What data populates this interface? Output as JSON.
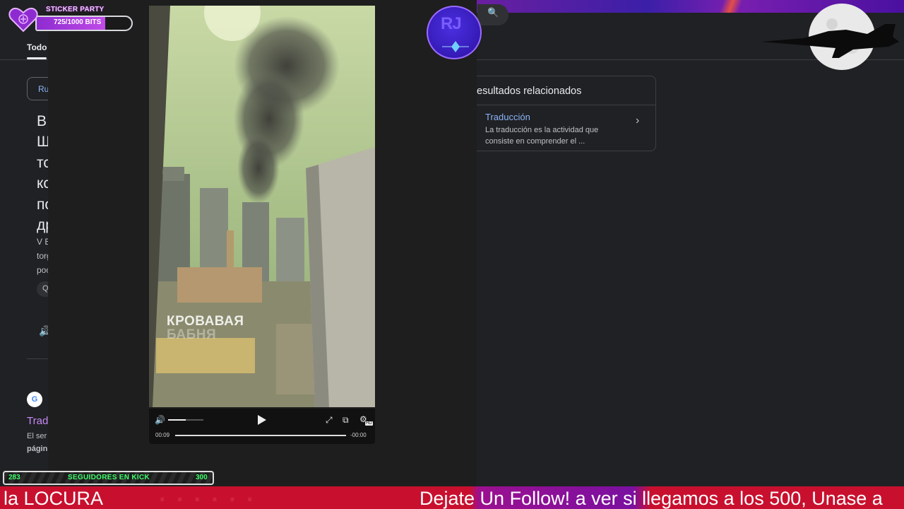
{
  "left_page": {
    "tab_all": "Todo",
    "chip": "Ru",
    "big_lines": [
      "В",
      "Щ",
      "тс",
      "кс",
      "пс",
      "др"
    ],
    "small_lines": [
      "V E",
      "torg",
      "poc"
    ],
    "pill": "Q",
    "translate_title": "Trad",
    "translate_desc": "El ser",
    "translate_more": "págin"
  },
  "overlay": {
    "sticker_label": "STICKER PARTY",
    "sticker_count": "725/1000 BITS",
    "sticker_progress": 0.725,
    "logo_text": "RJ",
    "followers_current": "283",
    "followers_label": "SEGUIDORES EN KICK",
    "followers_goal": "300",
    "ticker_left": "la LOCURA",
    "ticker_right": "Dejate Un Follow!  a ver si llegamos a los 500, Unase a",
    "accent_purple": "#8e2bd0",
    "ticker_red": "#c8102e"
  },
  "video": {
    "watermark_line1": "КРОВАВАЯ",
    "watermark_line2": "БАБНЯ",
    "time_current": "00:09",
    "time_remaining": "-00:00",
    "volume_level": 0.5,
    "hd_badge": "HD"
  },
  "right_page": {
    "related_title": "esultados relacionados",
    "item_title": "Traducción",
    "item_desc": "La traducción es la actividad que consiste en comprender el ..."
  }
}
